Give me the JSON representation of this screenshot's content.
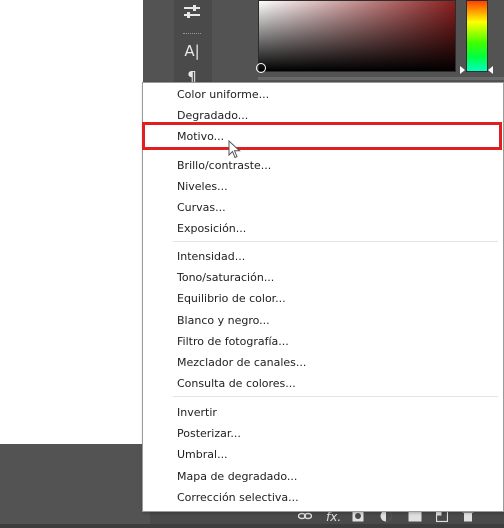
{
  "colors": {
    "highlight": "#e02020",
    "panel_bg": "#535353",
    "menu_text": "#1e1e1e"
  },
  "tools": {
    "adjust_icon": "sliders-icon",
    "text_icon": "text-tool-icon",
    "text_glyph": "A|",
    "paragraph_icon": "paragraph-icon",
    "paragraph_glyph": "¶"
  },
  "menu": {
    "items": [
      {
        "label": "Color uniforme..."
      },
      {
        "label": "Degradado..."
      },
      {
        "label": "Motivo..."
      },
      {
        "label": "Brillo/contraste..."
      },
      {
        "label": "Niveles..."
      },
      {
        "label": "Curvas..."
      },
      {
        "label": "Exposición..."
      },
      {
        "label": "Intensidad..."
      },
      {
        "label": "Tono/saturación..."
      },
      {
        "label": "Equilibrio de color..."
      },
      {
        "label": "Blanco y negro..."
      },
      {
        "label": "Filtro de fotografía..."
      },
      {
        "label": "Mezclador de canales..."
      },
      {
        "label": "Consulta de colores..."
      },
      {
        "label": "Invertir"
      },
      {
        "label": "Posterizar..."
      },
      {
        "label": "Umbral..."
      },
      {
        "label": "Mapa de degradado..."
      },
      {
        "label": "Corrección selectiva..."
      }
    ],
    "highlighted_item": "Motivo..."
  },
  "bottom_bar": {
    "fx_label": "fx.",
    "icons": [
      "link-icon",
      "fx-icon",
      "mask-icon",
      "adjustment-layer-icon",
      "group-icon",
      "new-layer-icon",
      "trash-icon"
    ]
  }
}
